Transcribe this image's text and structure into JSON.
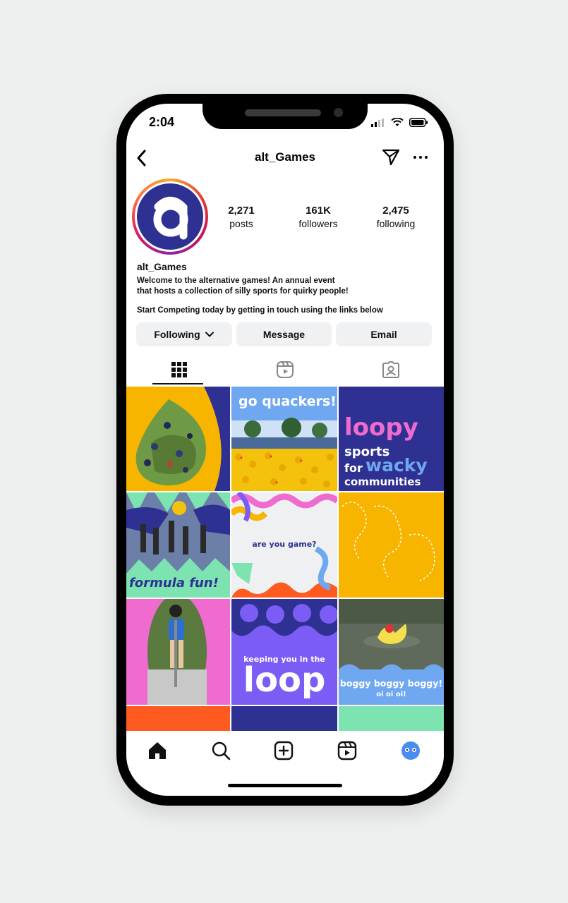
{
  "status_bar": {
    "time": "2:04"
  },
  "header": {
    "username": "alt_Games"
  },
  "profile": {
    "display_name": "alt_Games",
    "avatar_letter": "a",
    "stats": [
      {
        "value": "2,271",
        "label": "posts"
      },
      {
        "value": "161K",
        "label": "followers"
      },
      {
        "value": "2,475",
        "label": "following"
      }
    ],
    "bio_line1": "Welcome to the alternative games! An annual event",
    "bio_line2": "that hosts a collection of silly sports for quirky people!",
    "bio_line3": "Start Competing today by getting in touch using the links below"
  },
  "buttons": {
    "following": "Following",
    "message": "Message",
    "email": "Email"
  },
  "tabs": [
    "grid-icon",
    "reels-icon",
    "tagged-icon"
  ],
  "posts": {
    "tile2_text": "go quackers!",
    "tile3_line1": "loopy",
    "tile3_line2": "sports",
    "tile3_line3": "for",
    "tile3_line4": "wacky",
    "tile3_line5": "communities",
    "tile4_text": "formula fun!",
    "tile5_text": "are you game?",
    "tile8_line1": "keeping you in the",
    "tile8_line2": "loop",
    "tile9_line1": "boggy boggy boggy!",
    "tile9_line2": "oi oi oi!"
  },
  "nav": [
    "home-icon",
    "search-icon",
    "create-icon",
    "reels-icon",
    "profile-avatar"
  ],
  "colors": {
    "brand_navy": "#2e3192",
    "yellow": "#f7b500",
    "pink": "#f06bd0",
    "purple": "#7b5cf5",
    "mint": "#7de3b0",
    "orange": "#ff5a1f",
    "sky": "#6fa8f0"
  }
}
